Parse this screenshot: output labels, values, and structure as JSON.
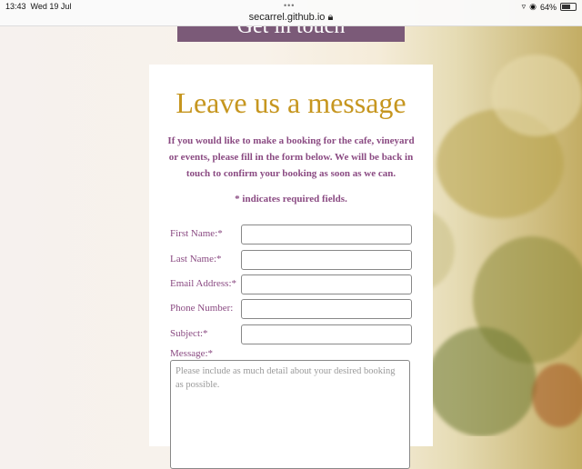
{
  "status_bar": {
    "time": "13:43",
    "date": "Wed 19 Jul",
    "url": "secarrel.github.io",
    "battery": "64%",
    "battery_level": 0.64,
    "dots": "•••"
  },
  "banner": {
    "text": "Get in touch"
  },
  "form": {
    "title": "Leave us a message",
    "intro": "If you would like to make a booking for the cafe, vineyard or events, please fill in the form below. We will be back in touch to confirm your booking as soon as we can.",
    "required_note": "* indicates required fields.",
    "fields": [
      {
        "label": "First Name:*",
        "value": ""
      },
      {
        "label": "Last Name:*",
        "value": ""
      },
      {
        "label": "Email Address:*",
        "value": ""
      },
      {
        "label": "Phone Number:",
        "value": ""
      },
      {
        "label": "Subject:*",
        "value": ""
      }
    ],
    "message_label": "Message:*",
    "message_placeholder": "Please include as much detail about your desired booking as possible."
  },
  "colors": {
    "title": "#c6961f",
    "text": "#8a4a82",
    "banner": "#7b5a78"
  }
}
